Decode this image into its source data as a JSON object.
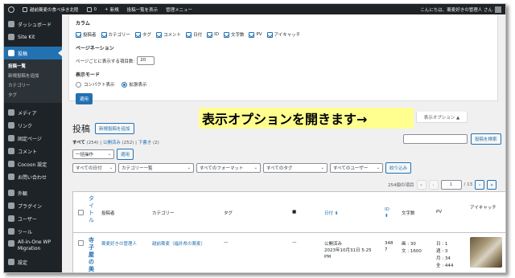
{
  "adminbar": {
    "site_name": "越前蕎麦の食べ歩き北陸",
    "comments_count": "0",
    "new_label": "新規",
    "view_posts": "投稿一覧を表示",
    "admin_menu": "管理メニュー",
    "greeting": "こんにちは、蕎麦好きの管理人 さん"
  },
  "sidebar": {
    "items": [
      {
        "label": "ダッシュボード",
        "icon": "dashboard-icon"
      },
      {
        "label": "Site Kit",
        "icon": "sitekit-icon"
      },
      {
        "label": "投稿",
        "icon": "pin-icon",
        "current": true
      },
      {
        "label": "メディア",
        "icon": "media-icon"
      },
      {
        "label": "リンク",
        "icon": "link-icon"
      },
      {
        "label": "固定ページ",
        "icon": "page-icon"
      },
      {
        "label": "コメント",
        "icon": "comment-icon"
      },
      {
        "label": "Cocoon 設定",
        "icon": "cocoon-icon"
      },
      {
        "label": "お問い合わせ",
        "icon": "mail-icon"
      },
      {
        "label": "外観",
        "icon": "appearance-icon"
      },
      {
        "label": "プラグイン",
        "icon": "plugin-icon"
      },
      {
        "label": "ユーザー",
        "icon": "user-icon"
      },
      {
        "label": "ツール",
        "icon": "tool-icon"
      },
      {
        "label": "All-in-One WP Migration",
        "icon": "migration-icon"
      },
      {
        "label": "設定",
        "icon": "settings-icon"
      }
    ],
    "submenu": [
      "投稿一覧",
      "新規投稿を追加",
      "カテゴリー",
      "タグ"
    ]
  },
  "screen_options": {
    "columns_title": "カラム",
    "columns": [
      "投稿者",
      "カテゴリー",
      "タグ",
      "コメント",
      "日付",
      "ID",
      "文字数",
      "PV",
      "アイキャッチ"
    ],
    "pagination_title": "ページネーション",
    "per_page_label": "ページごとに表示する項目数:",
    "per_page_value": "20",
    "view_mode_title": "表示モード",
    "compact_label": "コンパクト表示",
    "extended_label": "拡張表示",
    "apply_label": "適用",
    "tab_label": "表示オプション ▲"
  },
  "annotation": "表示オプションを開きます→",
  "page": {
    "title": "投稿",
    "add_new": "新規投稿を追加",
    "views": {
      "all": "すべて",
      "all_count": "(254)",
      "published": "公開済み",
      "published_count": "(252)",
      "draft": "下書き",
      "draft_count": "(2)",
      "sep": "|"
    },
    "search_button": "投稿を検索"
  },
  "filters": {
    "bulk": "一括操作",
    "apply": "適用",
    "date": "すべての日付",
    "category": "カテゴリー一覧",
    "format": "すべてのフォーマット",
    "tag": "すべてのタグ",
    "user": "すべてのユーザー",
    "filter_button": "絞り込み"
  },
  "pagination": {
    "items": "254個の項目",
    "first": "«",
    "prev": "‹",
    "current": "1",
    "total": "/ 13",
    "next": "›",
    "last": "»"
  },
  "table": {
    "headers": {
      "title": "タイトル",
      "author": "投稿者",
      "category": "カテゴリー",
      "tag": "タグ",
      "comment": "■",
      "date": "日付 ⬍",
      "id": "ID ⬍",
      "chars": "文字数",
      "pv": "PV",
      "thumb": "アイキャッチ"
    },
    "row": {
      "title": "寺子屋の美麦",
      "author": "蕎麦好きの管理人",
      "category": "越前蕎麦（福井県の蕎麦）",
      "tag": "—",
      "comment": "—",
      "status": "公開済み",
      "date": "2023年10月31日 5:25 PM",
      "id": "348 7",
      "chars_img": "画 : 30",
      "chars_text": "文 : 1600",
      "pv_day": "日 : 1",
      "pv_week": "週 : 3",
      "pv_month": "月 : 34",
      "pv_all": "全 : 444"
    }
  }
}
